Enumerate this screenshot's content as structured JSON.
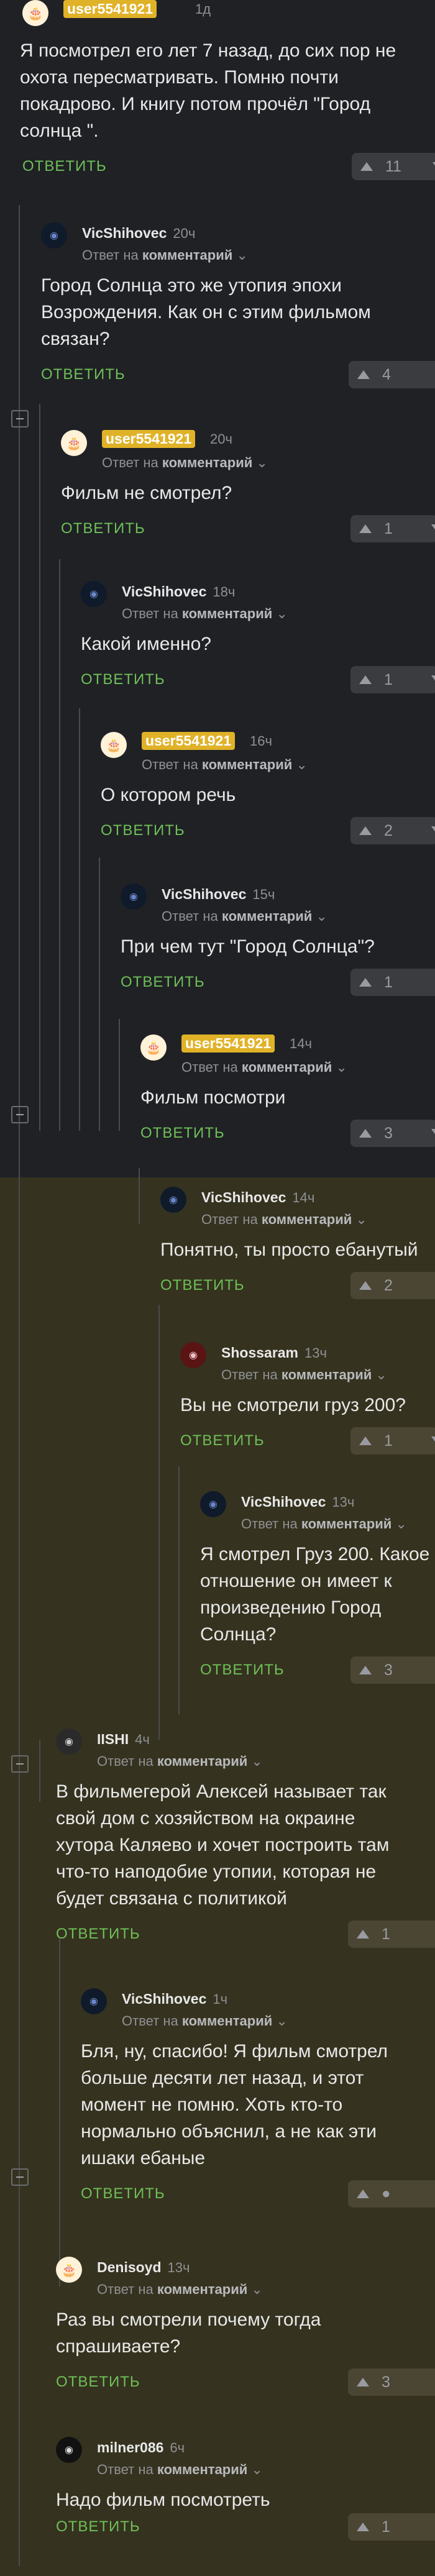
{
  "labels": {
    "reply": "ОТВЕТИТЬ",
    "reply_to_prefix": "Ответ на",
    "reply_to_target": "комментарий"
  },
  "comments": [
    {
      "author": "user5541921",
      "time": "1д",
      "text": "Я посмотрел его лет 7 назад, до сих пор не охота пересматривать. Помню почти покадрово. И книгу потом прочёл \"Город солнца \".",
      "rating": "11",
      "avatar_icon": "cake-avatar-icon"
    },
    {
      "author": "VicShihovec",
      "time": "20ч",
      "text": "Город Солнца это же утопия эпохи Возрождения. Как он с этим фильмом связан?",
      "rating": "4",
      "avatar_icon": "user-avatar-icon"
    },
    {
      "author": "user5541921",
      "time": "20ч",
      "text": "Фильм не смотрел?",
      "rating": "1",
      "avatar_icon": "cake-avatar-icon"
    },
    {
      "author": "VicShihovec",
      "time": "18ч",
      "text": "Какой именно?",
      "rating": "1",
      "avatar_icon": "user-avatar-icon"
    },
    {
      "author": "user5541921",
      "time": "16ч",
      "text": "О котором речь",
      "rating": "2",
      "avatar_icon": "cake-avatar-icon"
    },
    {
      "author": "VicShihovec",
      "time": "15ч",
      "text": "При чем тут \"Город Солнца\"?",
      "rating": "1",
      "avatar_icon": "user-avatar-icon"
    },
    {
      "author": "user5541921",
      "time": "14ч",
      "text": "Фильм посмотри",
      "rating": "3",
      "avatar_icon": "cake-avatar-icon"
    },
    {
      "author": "VicShihovec",
      "time": "14ч",
      "text": "Понятно, ты просто ебанутый",
      "rating": "2",
      "avatar_icon": "user-avatar-icon"
    },
    {
      "author": "Shossaram",
      "time": "13ч",
      "text": "Вы не смотрели груз 200?",
      "rating": "1",
      "avatar_icon": "user-avatar-icon"
    },
    {
      "author": "VicShihovec",
      "time": "13ч",
      "text": "Я смотрел Груз 200. Какое отношение он имеет к произведению Город Солнца?",
      "rating": "3",
      "avatar_icon": "user-avatar-icon"
    },
    {
      "author": "IISHI",
      "time": "4ч",
      "text": "В фильмегерой Алексей называет так свой дом с хозяйством на окраине хутора Каляево и хочет построить там что-то наподобие утопии, которая не будет связана с политикой",
      "rating": "1",
      "avatar_icon": "user-avatar-icon"
    },
    {
      "author": "VicShihovec",
      "time": "1ч",
      "text": "Бля, ну, спасибо! Я фильм смотрел больше десяти лет назад, и этот момент не помню. Хоть кто-то нормально объяснил, а не как эти ишаки ебаные",
      "rating": "●",
      "avatar_icon": "user-avatar-icon"
    },
    {
      "author": "Denisoyd",
      "time": "13ч",
      "text": "Раз вы смотрели почему тогда спрашиваете?",
      "rating": "3",
      "avatar_icon": "cake-avatar-icon"
    },
    {
      "author": "milner086",
      "time": "6ч",
      "text": "Надо фильм посмотреть",
      "rating": "1",
      "avatar_icon": "user-avatar-icon"
    }
  ]
}
